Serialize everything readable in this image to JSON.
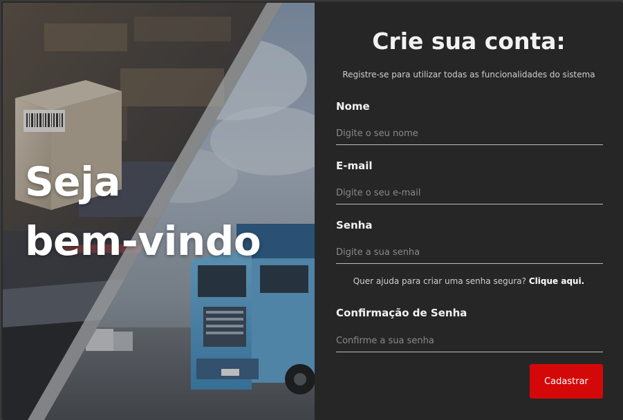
{
  "hero": {
    "line1": "Seja",
    "line2": "bem-vindo"
  },
  "form": {
    "title": "Crie sua conta:",
    "subtitle": "Registre-se para utilizar todas as funcionalidades do sistema",
    "fields": [
      {
        "label": "Nome",
        "placeholder": "Digite o seu nome"
      },
      {
        "label": "E-mail",
        "placeholder": "Digite o seu e-mail"
      },
      {
        "label": "Senha",
        "placeholder": "Digite a sua senha"
      },
      {
        "label": "Confirmação de Senha",
        "placeholder": "Confirme a sua senha"
      }
    ],
    "help_text": "Quer ajuda para criar uma senha segura?",
    "help_link": "Clique aqui.",
    "submit_label": "Cadastrar"
  },
  "colors": {
    "panel_bg": "#262626",
    "button": "#d40808",
    "text": "#f2f2f2"
  }
}
